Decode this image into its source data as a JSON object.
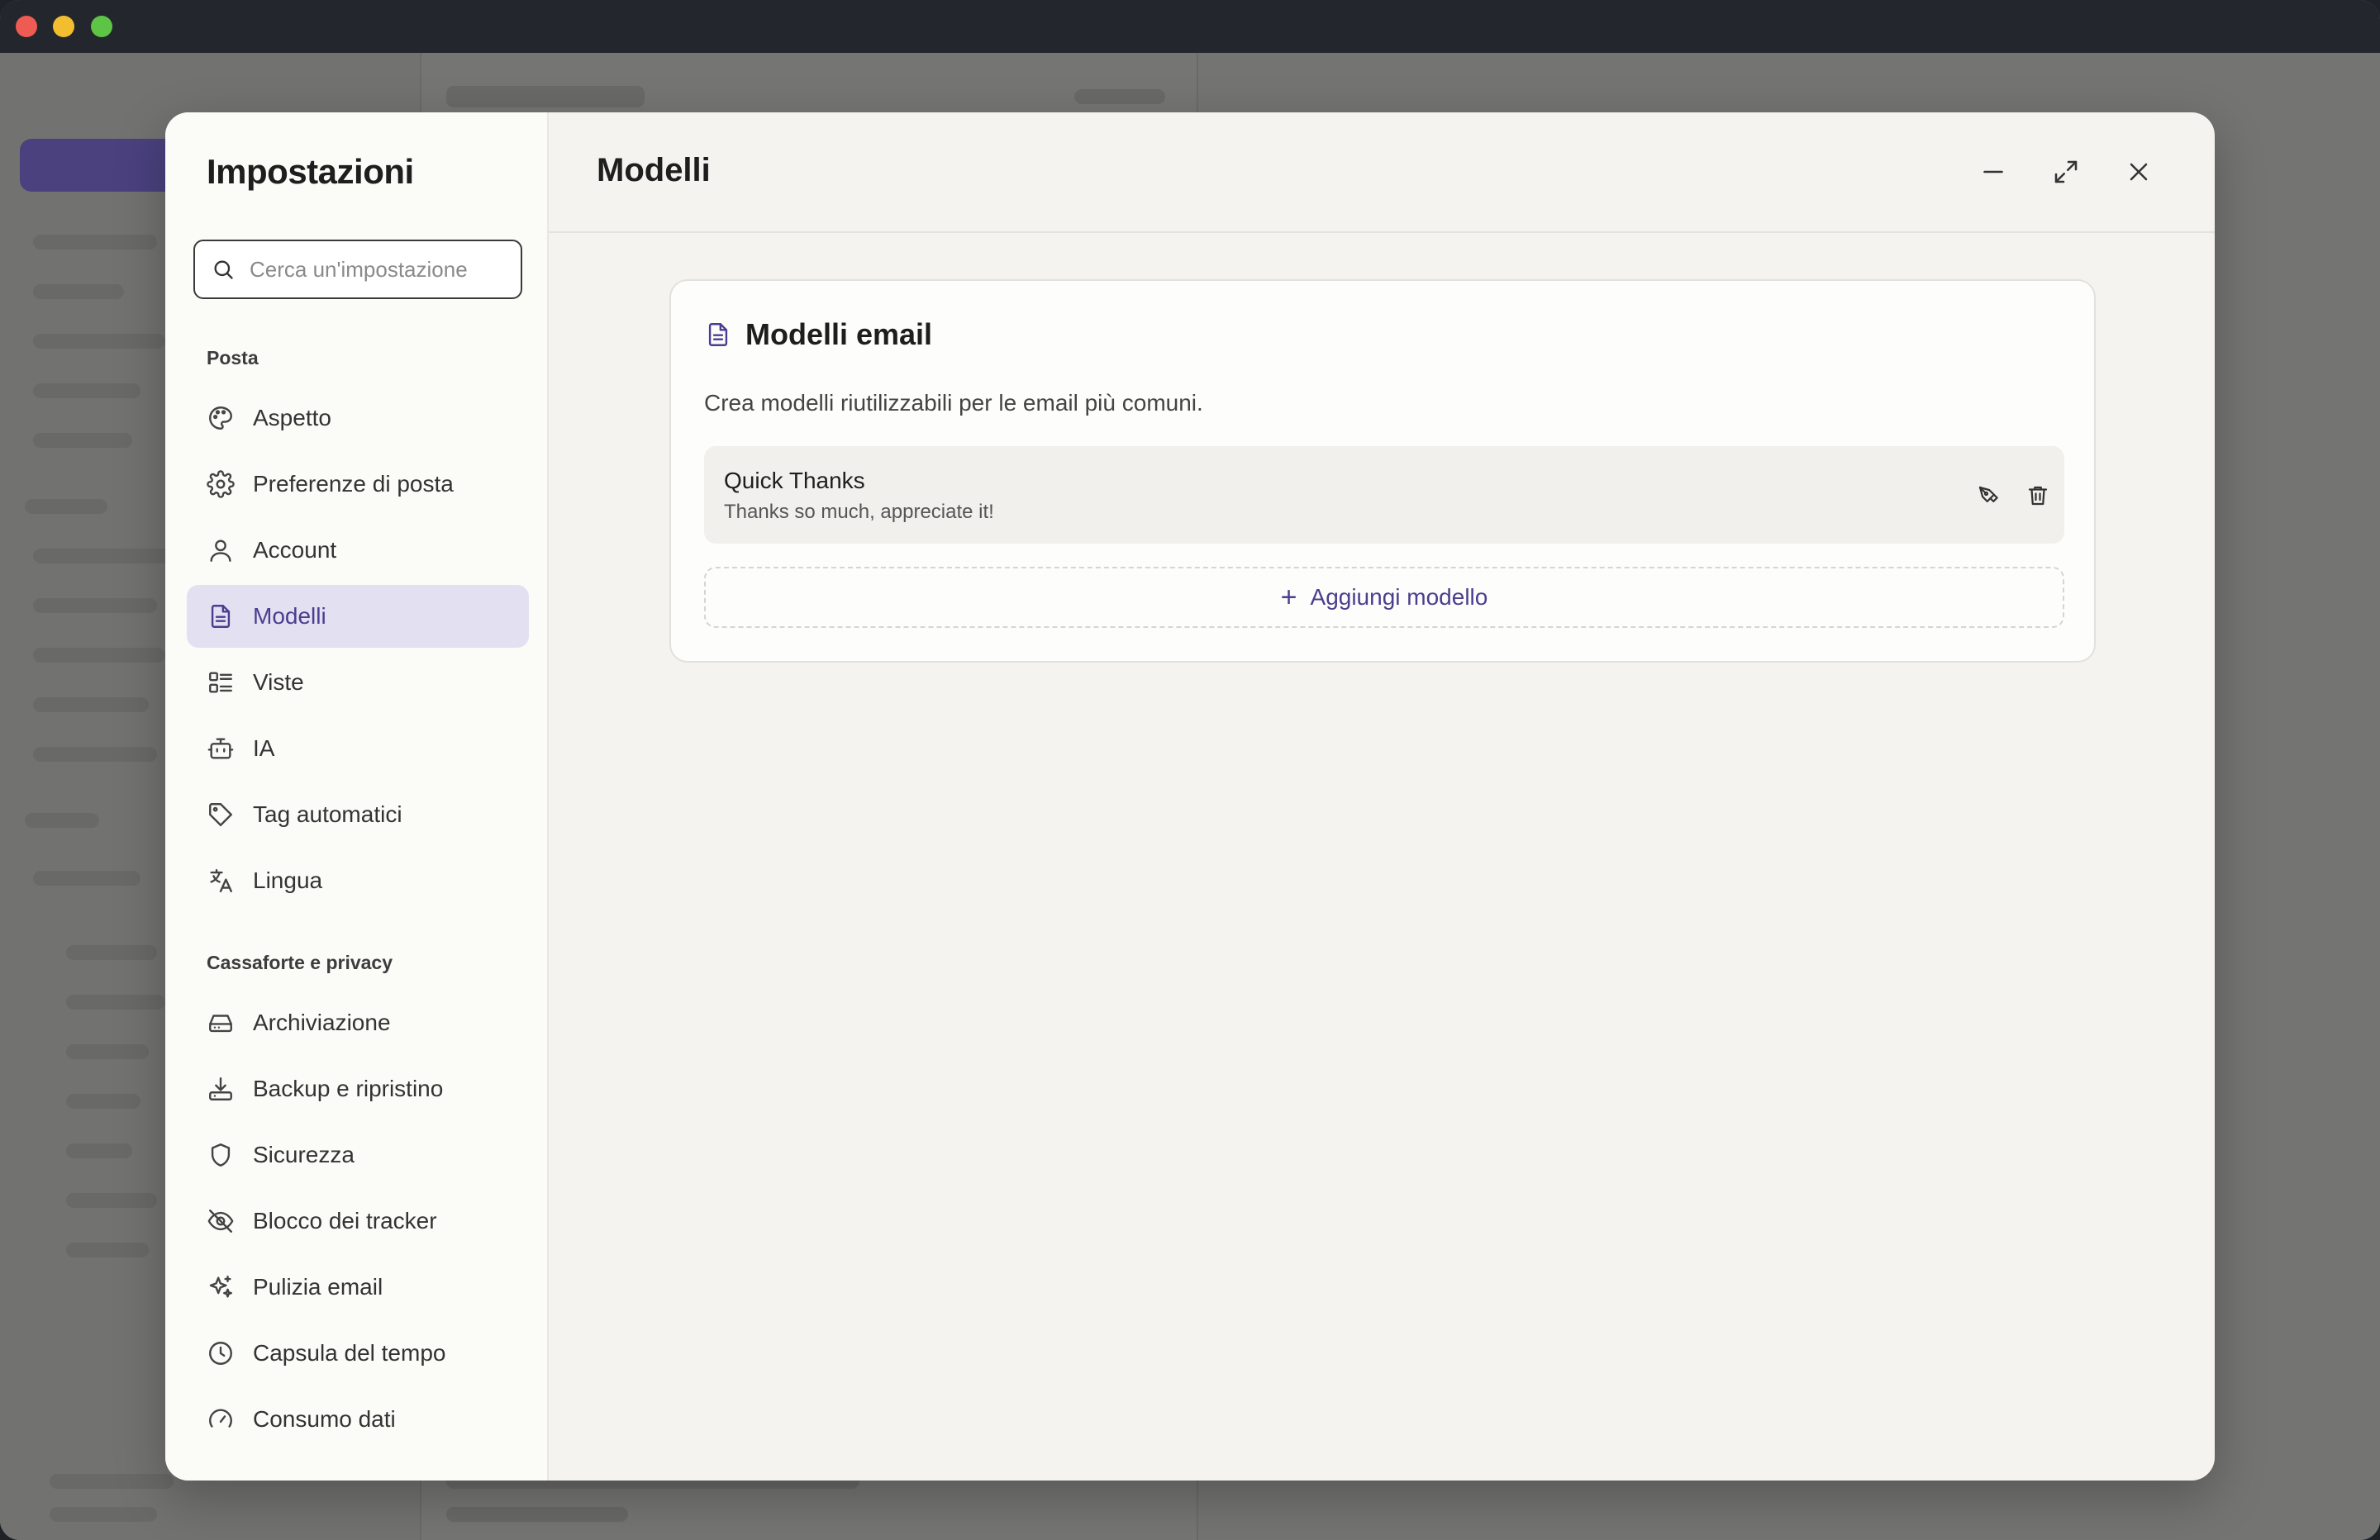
{
  "modal": {
    "title": "Impostazioni",
    "search_placeholder": "Cerca un'impostazione"
  },
  "nav": {
    "section_mail": "Posta",
    "section_vault": "Cassaforte e privacy",
    "items": [
      {
        "label": "Aspetto",
        "icon": "palette-icon"
      },
      {
        "label": "Preferenze di posta",
        "icon": "gear-icon"
      },
      {
        "label": "Account",
        "icon": "user-icon"
      },
      {
        "label": "Modelli",
        "icon": "document-icon",
        "active": true
      },
      {
        "label": "Viste",
        "icon": "list-view-icon"
      },
      {
        "label": "IA",
        "icon": "bot-icon"
      },
      {
        "label": "Tag automatici",
        "icon": "tag-icon"
      },
      {
        "label": "Lingua",
        "icon": "translate-icon"
      },
      {
        "label": "Archiviazione",
        "icon": "hard-drive-icon"
      },
      {
        "label": "Backup e ripristino",
        "icon": "download-tray-icon"
      },
      {
        "label": "Sicurezza",
        "icon": "shield-icon"
      },
      {
        "label": "Blocco dei tracker",
        "icon": "eye-off-icon"
      },
      {
        "label": "Pulizia email",
        "icon": "sparkles-icon"
      },
      {
        "label": "Capsula del tempo",
        "icon": "clock-icon"
      },
      {
        "label": "Consumo dati",
        "icon": "gauge-icon"
      }
    ]
  },
  "main": {
    "title": "Modelli",
    "card_title": "Modelli email",
    "card_description": "Crea modelli riutilizzabili per le email più comuni.",
    "templates": [
      {
        "name": "Quick Thanks",
        "body": "Thanks so much, appreciate it!"
      }
    ],
    "add_label": "Aggiungi modello"
  },
  "colors": {
    "accent": "#4a3e8e",
    "active_bg": "#e3e0f1"
  }
}
